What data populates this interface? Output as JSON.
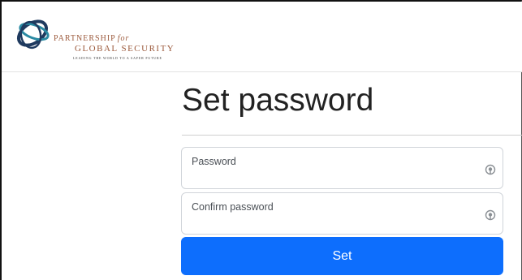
{
  "header": {
    "logo": {
      "name_line1": "PARTNERSHIP",
      "name_for": "for",
      "name_line2": "GLOBAL SECURITY",
      "tagline": "LEADING THE WORLD TO A SAFER FUTURE",
      "icon": "globe-orbit-icon"
    }
  },
  "main": {
    "title": "Set password",
    "password_field": {
      "label": "Password",
      "value": "",
      "icon": "reveal-eye-icon"
    },
    "confirm_field": {
      "label": "Confirm password",
      "value": "",
      "icon": "reveal-eye-icon"
    },
    "submit_label": "Set"
  },
  "colors": {
    "primary_button": "#0d6efd",
    "logo_text": "#9c5a3c",
    "logo_navy": "#1f3a5f",
    "logo_teal": "#2a8aa3"
  }
}
